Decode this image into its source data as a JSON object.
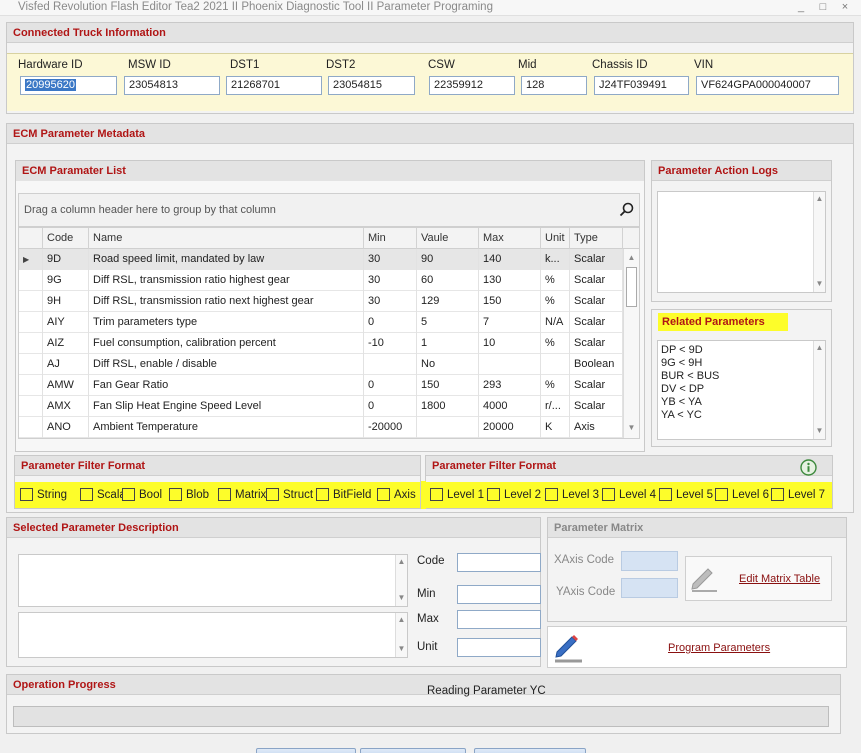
{
  "window": {
    "title": "Visfed Revolution Flash Editor Tea2 2021 II Phoenix Diagnostic Tool II Parameter Programing",
    "minimize": "_",
    "maximize": "□",
    "close": "×"
  },
  "truck": {
    "header": "Connected Truck Information",
    "fields": [
      {
        "label": "Hardware ID",
        "value": "20995620"
      },
      {
        "label": "MSW ID",
        "value": "23054813"
      },
      {
        "label": "DST1",
        "value": "21268701"
      },
      {
        "label": "DST2",
        "value": "23054815"
      },
      {
        "label": "CSW",
        "value": "22359912"
      },
      {
        "label": "Mid",
        "value": "128"
      },
      {
        "label": "Chassis ID",
        "value": "J24TF039491"
      },
      {
        "label": "VIN",
        "value": "VF624GPA000040007"
      }
    ]
  },
  "metadata": {
    "header": "ECM Parameter Metadata"
  },
  "param_list": {
    "header": "ECM Paramater List",
    "group_hint": "Drag a column header here to group by that column",
    "columns": [
      "Code",
      "Name",
      "Min",
      "Vaule",
      "Max",
      "Unit",
      "Type"
    ],
    "rows": [
      [
        "9D",
        "Road speed limit, mandated by law",
        "30",
        "90",
        "140",
        "k...",
        "Scalar"
      ],
      [
        "9G",
        "Diff RSL, transmission ratio highest gear",
        "30",
        "60",
        "130",
        "%",
        "Scalar"
      ],
      [
        "9H",
        "Diff RSL, transmission ratio next highest gear",
        "30",
        "129",
        "150",
        "%",
        "Scalar"
      ],
      [
        "AIY",
        "Trim parameters type",
        "0",
        "5",
        "7",
        "N/A",
        "Scalar"
      ],
      [
        "AIZ",
        "Fuel consumption, calibration percent",
        "-10",
        "1",
        "10",
        "%",
        "Scalar"
      ],
      [
        "AJ",
        "Diff RSL, enable / disable",
        "",
        "No",
        "",
        "",
        "Boolean"
      ],
      [
        "AMW",
        "Fan Gear Ratio",
        "0",
        "150",
        "293",
        "%",
        "Scalar"
      ],
      [
        "AMX",
        "Fan Slip Heat Engine Speed Level",
        "0",
        "1800",
        "4000",
        "r/...",
        "Scalar"
      ],
      [
        "ANO",
        "Ambient Temperature",
        "-20000",
        "",
        "20000",
        "K",
        "Axis"
      ]
    ]
  },
  "action_logs": {
    "header": "Parameter Action Logs"
  },
  "related": {
    "header": "Related Parameters",
    "items": [
      "DP < 9D",
      "9G < 9H",
      "BUR < BUS",
      "DV < DP",
      "YB < YA",
      "YA < YC"
    ]
  },
  "filter_format": {
    "header": "Parameter Filter Format",
    "options": [
      "String",
      "Scalar",
      "Bool",
      "Blob",
      "Matrix",
      "Struct",
      "BitField",
      "Axis"
    ]
  },
  "filter_levels": {
    "header": "Parameter Filter Format",
    "options": [
      "Level 1",
      "Level 2",
      "Level 3",
      "Level 4",
      "Level 5",
      "Level 6",
      "Level 7"
    ]
  },
  "description": {
    "header": "Selected Parameter Description",
    "labels": {
      "code": "Code",
      "min": "Min",
      "max": "Max",
      "unit": "Unit"
    }
  },
  "matrix": {
    "header": "Parameter Matrix",
    "xaxis_label": "XAxis Code",
    "yaxis_label": "YAxis Code",
    "edit_link": "Edit Matrix Table",
    "program_link": "Program Parameters"
  },
  "progress": {
    "header": "Operation Progress",
    "status": "Reading Parameter YC",
    "percent": 0
  },
  "colors": {
    "accent_red": "#b01515",
    "highlight_yellow": "#fdfd2a",
    "selection_blue": "#3b78c6"
  }
}
